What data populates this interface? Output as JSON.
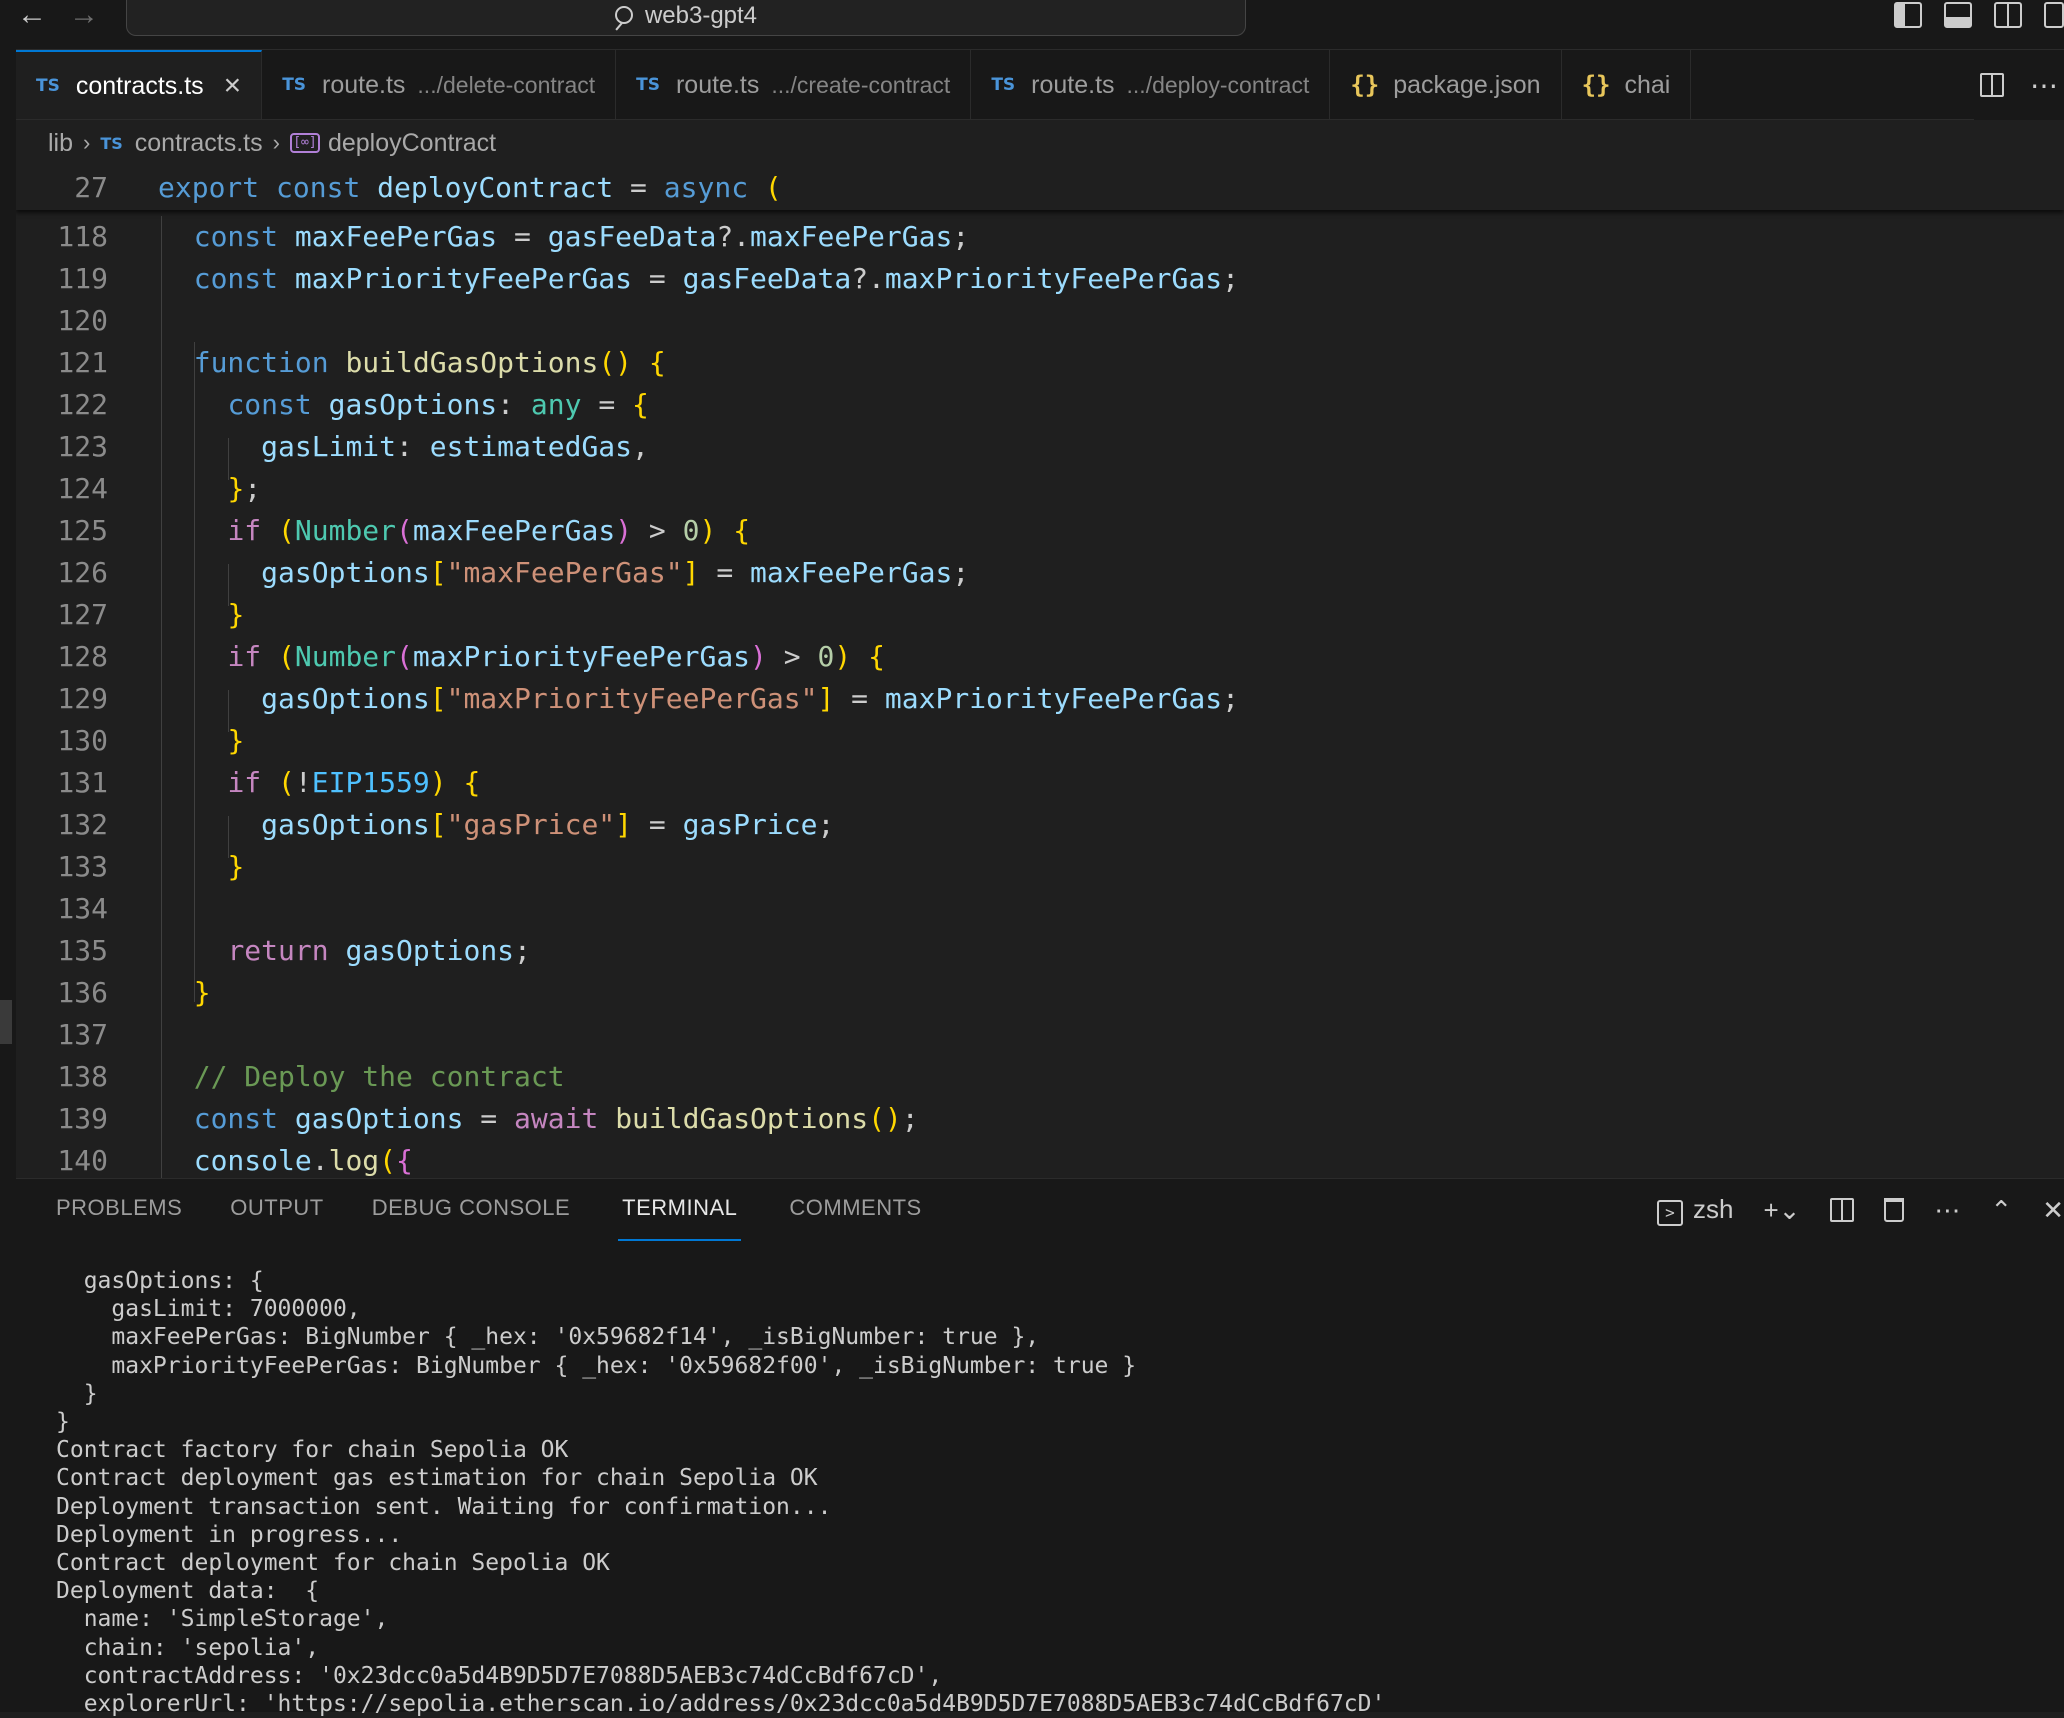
{
  "window": {
    "title": "web3-gpt4"
  },
  "tabs": [
    {
      "kind": "TS",
      "name": "contracts.ts",
      "desc": "",
      "active": true
    },
    {
      "kind": "TS",
      "name": "route.ts",
      "desc": ".../delete-contract",
      "active": false
    },
    {
      "kind": "TS",
      "name": "route.ts",
      "desc": ".../create-contract",
      "active": false
    },
    {
      "kind": "TS",
      "name": "route.ts",
      "desc": ".../deploy-contract",
      "active": false
    },
    {
      "kind": "{}",
      "name": "package.json",
      "desc": "",
      "active": false
    },
    {
      "kind": "{}",
      "name": "chai",
      "desc": "",
      "active": false
    }
  ],
  "breadcrumb": {
    "folder": "lib",
    "file_kind": "TS",
    "file": "contracts.ts",
    "symbol": "deployContract"
  },
  "editor": {
    "sticky": {
      "num": "27",
      "text": "export const deployContract = async ("
    },
    "lines": [
      {
        "num": "118",
        "text": "  const maxFeePerGas = gasFeeData?.maxFeePerGas;"
      },
      {
        "num": "119",
        "text": "  const maxPriorityFeePerGas = gasFeeData?.maxPriorityFeePerGas;"
      },
      {
        "num": "120",
        "text": ""
      },
      {
        "num": "121",
        "text": "  function buildGasOptions() {"
      },
      {
        "num": "122",
        "text": "    const gasOptions: any = {"
      },
      {
        "num": "123",
        "text": "      gasLimit: estimatedGas,"
      },
      {
        "num": "124",
        "text": "    };"
      },
      {
        "num": "125",
        "text": "    if (Number(maxFeePerGas) > 0) {"
      },
      {
        "num": "126",
        "text": "      gasOptions[\"maxFeePerGas\"] = maxFeePerGas;"
      },
      {
        "num": "127",
        "text": "    }"
      },
      {
        "num": "128",
        "text": "    if (Number(maxPriorityFeePerGas) > 0) {"
      },
      {
        "num": "129",
        "text": "      gasOptions[\"maxPriorityFeePerGas\"] = maxPriorityFeePerGas;"
      },
      {
        "num": "130",
        "text": "    }"
      },
      {
        "num": "131",
        "text": "    if (!EIP1559) {"
      },
      {
        "num": "132",
        "text": "      gasOptions[\"gasPrice\"] = gasPrice;"
      },
      {
        "num": "133",
        "text": "    }"
      },
      {
        "num": "134",
        "text": ""
      },
      {
        "num": "135",
        "text": "    return gasOptions;"
      },
      {
        "num": "136",
        "text": "  }"
      },
      {
        "num": "137",
        "text": ""
      },
      {
        "num": "138",
        "text": "  // Deploy the contract"
      },
      {
        "num": "139",
        "text": "  const gasOptions = await buildGasOptions();"
      },
      {
        "num": "140",
        "text": "  console.log({"
      }
    ]
  },
  "panel": {
    "tabs": [
      "PROBLEMS",
      "OUTPUT",
      "DEBUG CONSOLE",
      "TERMINAL",
      "COMMENTS"
    ],
    "active_tab": "TERMINAL",
    "shell": "zsh"
  },
  "terminal": {
    "lines": [
      "  gasOptions: {",
      "    gasLimit: 7000000,",
      "    maxFeePerGas: BigNumber { _hex: '0x59682f14', _isBigNumber: true },",
      "    maxPriorityFeePerGas: BigNumber { _hex: '0x59682f00', _isBigNumber: true }",
      "  }",
      "}",
      "Contract factory for chain Sepolia OK",
      "Contract deployment gas estimation for chain Sepolia OK",
      "Deployment transaction sent. Waiting for confirmation...",
      "Deployment in progress...",
      "Contract deployment for chain Sepolia OK",
      "Deployment data:  {",
      "  name: 'SimpleStorage',",
      "  chain: 'sepolia',",
      "  contractAddress: '0x23dcc0a5d4B9D5D7E7088D5AEB3c74dCcBdf67cD',",
      "  explorerUrl: 'https://sepolia.etherscan.io/address/0x23dcc0a5d4B9D5D7E7088D5AEB3c74dCcBdf67cD'"
    ]
  },
  "colors": {
    "accent": "#0078d4",
    "editor_bg": "#1f1f1f",
    "panel_bg": "#181818"
  }
}
